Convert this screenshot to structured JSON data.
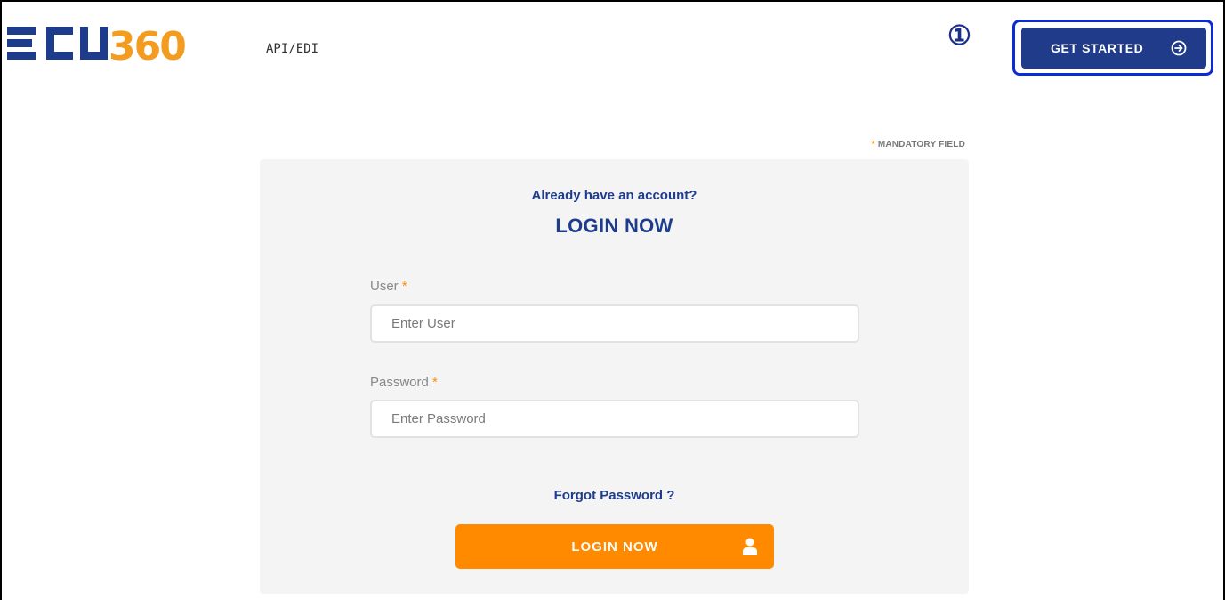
{
  "header": {
    "logo_text": "ECU360",
    "nav_link": "API/EDI",
    "marker": "①",
    "get_started_label": "GET STARTED",
    "get_started_icon": "arrow-circle-right-icon"
  },
  "form": {
    "mandatory_star": "*",
    "mandatory_text": "MANDATORY FIELD",
    "subtitle": "Already have an account?",
    "title": "LOGIN NOW",
    "user_label": "User",
    "user_required": "*",
    "user_placeholder": "Enter User",
    "password_label": "Password",
    "password_required": "*",
    "password_placeholder": "Enter Password",
    "forgot_link": "Forgot Password ?",
    "login_button": "LOGIN NOW",
    "login_icon": "user-icon"
  },
  "colors": {
    "brand_blue": "#1e3c8c",
    "brand_orange": "#ff8a00",
    "highlight": "#0a2bd6"
  }
}
